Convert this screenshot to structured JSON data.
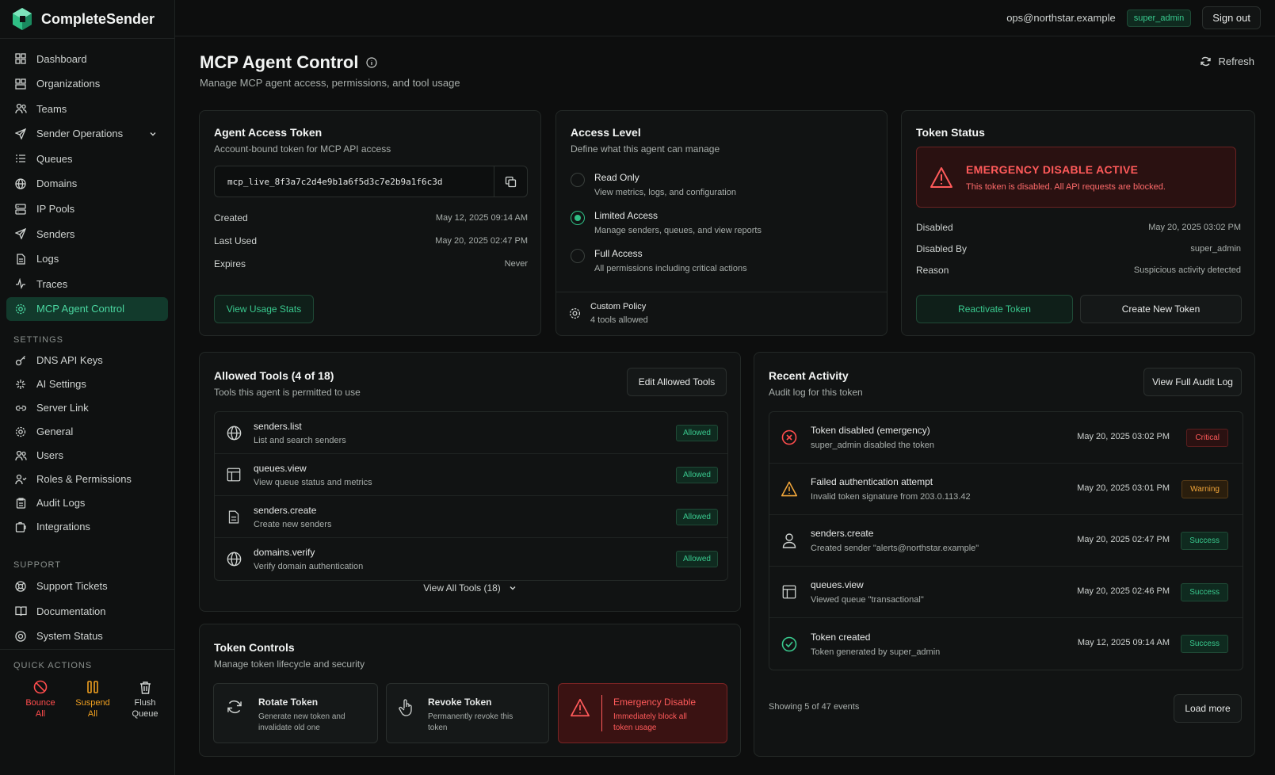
{
  "app": {
    "name": "CompleteSender"
  },
  "nav": [
    {
      "label": "Dashboard",
      "icon": "dashboard-icon"
    },
    {
      "label": "Organizations",
      "icon": "organizations-icon"
    },
    {
      "label": "Teams",
      "icon": "teams-icon"
    },
    {
      "label": "Sender Operations",
      "icon": "send-icon",
      "expandable": true
    },
    {
      "label": "Queues",
      "icon": "queue-icon"
    },
    {
      "label": "Domains",
      "icon": "globe-icon"
    },
    {
      "label": "IP Pools",
      "icon": "server-icon"
    },
    {
      "label": "Senders",
      "icon": "send-icon"
    },
    {
      "label": "Logs",
      "icon": "file-icon"
    },
    {
      "label": "Traces",
      "icon": "activity-icon"
    },
    {
      "label": "MCP Agent Control",
      "icon": "gear-icon",
      "active": true
    }
  ],
  "settings": {
    "title": "SETTINGS",
    "items": [
      "DNS API Keys",
      "AI Settings",
      "Server Link",
      "General",
      "Users",
      "Roles & Permissions",
      "Audit Logs",
      "Integrations"
    ]
  },
  "support": {
    "title": "SUPPORT",
    "items": [
      "Support Tickets",
      "Documentation",
      "System Status"
    ]
  },
  "quick_actions": {
    "title": "QUICK ACTIONS",
    "bounce": [
      "Bounce",
      "All"
    ],
    "suspend": [
      "Suspend",
      "All"
    ],
    "flush": [
      "Flush",
      "Queue"
    ],
    "colors": {
      "bounce": "#ff4d4d",
      "suspend": "#f0a020",
      "flush": "#cfd3d1"
    }
  },
  "topbar": {
    "email": "ops@northstar.example",
    "role": "super_admin",
    "signout": "Sign out"
  },
  "page": {
    "title": "MCP Agent Control",
    "subtitle": "Manage MCP agent access, permissions, and tool usage",
    "refresh": "Refresh"
  },
  "token_card": {
    "title": "Agent Access Token",
    "subtitle": "Account-bound token for MCP API access",
    "token": "mcp_live_8f3a7c2d4e9b1a6f5d3c7e2b9a1f6c3d",
    "created_label": "Created",
    "created": "May 12, 2025 09:14 AM",
    "last_used_label": "Last Used",
    "last_used": "May 20, 2025 02:47 PM",
    "expires_label": "Expires",
    "expires": "Never",
    "usage_btn": "View Usage Stats"
  },
  "access": {
    "title": "Access Level",
    "subtitle": "Define what this agent can manage",
    "options": [
      {
        "label": "Read Only",
        "desc": "View metrics, logs, and configuration",
        "selected": false
      },
      {
        "label": "Limited Access",
        "desc": "Manage senders, queues, and view reports",
        "selected": true
      },
      {
        "label": "Full Access",
        "desc": "All permissions including critical actions",
        "selected": false
      }
    ],
    "policy_title": "Custom Policy",
    "policy_desc": "4 tools allowed"
  },
  "status": {
    "title": "Token Status",
    "alert_title": "EMERGENCY DISABLE ACTIVE",
    "alert_desc": "This token is disabled. All API requests are blocked.",
    "disabled_label": "Disabled",
    "disabled": "May 20, 2025 03:02 PM",
    "by_label": "Disabled By",
    "by": "super_admin",
    "reason_label": "Reason",
    "reason": "Suspicious activity detected",
    "reactivate": "Reactivate Token",
    "create": "Create New Token"
  },
  "tools": {
    "title": "Allowed Tools (4 of 18)",
    "subtitle": "Tools this agent is permitted to use",
    "edit_btn": "Edit Allowed Tools",
    "items": [
      {
        "name": "senders.list",
        "desc": "List and search senders",
        "status": "Allowed"
      },
      {
        "name": "queues.view",
        "desc": "View queue status and metrics",
        "status": "Allowed"
      },
      {
        "name": "senders.create",
        "desc": "Create new senders",
        "status": "Allowed"
      },
      {
        "name": "domains.verify",
        "desc": "Verify domain authentication",
        "status": "Allowed"
      }
    ],
    "view_all": "View All Tools (18)"
  },
  "controls": {
    "title": "Token Controls",
    "subtitle": "Manage token lifecycle and security",
    "rotate_title": "Rotate Token",
    "rotate_desc": "Generate new token and invalidate old one",
    "revoke_title": "Revoke Token",
    "revoke_desc": "Permanently revoke this token",
    "emergency_title": "Emergency Disable",
    "emergency_desc": "Immediately block all token usage"
  },
  "activity": {
    "title": "Recent Activity",
    "subtitle": "Audit log for this token",
    "audit_btn": "View Full Audit Log",
    "items": [
      {
        "title": "Token disabled (emergency)",
        "desc": "super_admin disabled the token",
        "time": "May 20, 2025 03:02 PM",
        "badge": "Critical",
        "icon": "x-circle-icon"
      },
      {
        "title": "Failed authentication attempt",
        "desc": "Invalid token signature from 203.0.113.42",
        "time": "May 20, 2025 03:01 PM",
        "badge": "Warning",
        "icon": "warning-icon"
      },
      {
        "title": "senders.create",
        "desc": "Created sender \"alerts@northstar.example\"",
        "time": "May 20, 2025 02:47 PM",
        "badge": "Success",
        "icon": "user-icon"
      },
      {
        "title": "queues.view",
        "desc": "Viewed queue \"transactional\"",
        "time": "May 20, 2025 02:46 PM",
        "badge": "Success",
        "icon": "table-icon"
      },
      {
        "title": "Token created",
        "desc": "Token generated by super_admin",
        "time": "May 12, 2025 09:14 AM",
        "badge": "Success",
        "icon": "check-circle-icon"
      }
    ],
    "showing": "Showing 5 of 47 events",
    "load_more": "Load more"
  },
  "colors": {
    "accent": "#2fbf85",
    "danger": "#ff5a5a",
    "warning": "#f0a53a",
    "bg": "#0d0e0e"
  }
}
